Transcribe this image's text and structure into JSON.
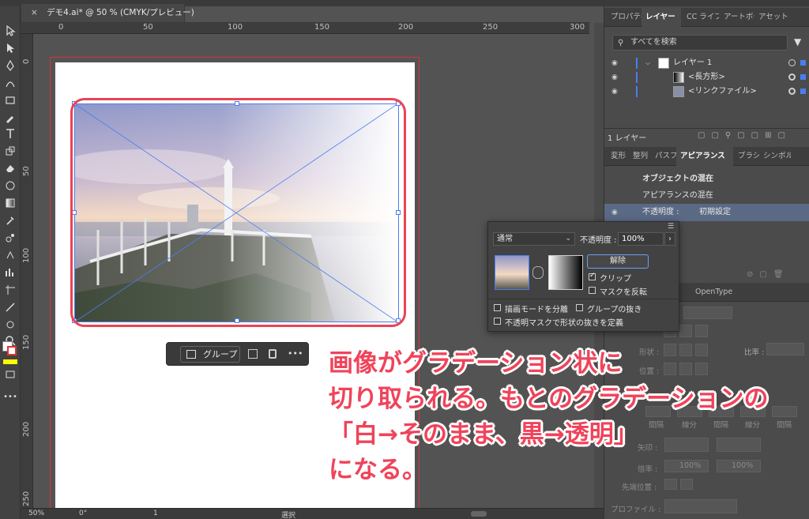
{
  "document_tab": {
    "close": "×",
    "title": "デモ4.ai* @ 50 % (CMYK/プレビュー)"
  },
  "ruler": {
    "h_ticks": [
      "0",
      "50",
      "100",
      "150",
      "200",
      "250",
      "300"
    ],
    "v_ticks": [
      "0",
      "50",
      "100",
      "150",
      "200",
      "250"
    ]
  },
  "context_bar": {
    "group_label": "グループ",
    "more": "•••"
  },
  "annotation": {
    "line1": "画像がグラデーション状に",
    "line2": "切り取られる。もとのグラデーションの",
    "line3": "「白→そのまま、黒→透明」",
    "line4": "になる。"
  },
  "status_bar": {
    "zoom": "50%",
    "rotate": "0°",
    "page": "1",
    "mode": "選択"
  },
  "panels": {
    "top_tabs": [
      "プロパティ",
      "レイヤー",
      "CC ライブラリ",
      "アートボード",
      "アセット"
    ],
    "search_placeholder": "すべてを検索",
    "layers": [
      {
        "name": "レイヤー 1"
      },
      {
        "name": "<長方形>"
      },
      {
        "name": "<リンクファイル>"
      }
    ],
    "layer_count": "1 レイヤー",
    "mid_tabs": [
      "変形",
      "整列",
      "パスファインダー",
      "アピアランス",
      "ブラシ",
      "シンボル"
    ],
    "appearance": {
      "row1": "オブジェクトの混在",
      "row2": "アピアランスの混在",
      "opacity_label": "不透明度 :",
      "opacity_value": "初期設定"
    },
    "stroke_tabs": [
      "OpenType"
    ],
    "stroke": {
      "ratio_label": "比率 :",
      "shape_label": "形状 :",
      "position_label": "位置 :",
      "line_labels": [
        "間隔",
        "線分",
        "間隔",
        "線分",
        "間隔"
      ],
      "arrow_label": "矢印 :",
      "scale_label": "倍率 :",
      "scale1": "100%",
      "scale2": "100%",
      "tip_label": "先端位置 :",
      "profile_label": "プロファイル :"
    }
  },
  "transparency": {
    "blend_mode": "通常",
    "opacity_label": "不透明度 :",
    "opacity_value": "100%",
    "release_button": "解除",
    "clip_label": "クリップ",
    "clip_checked": true,
    "invert_label": "マスクを反転",
    "invert_checked": false,
    "isolate_label": "描画モードを分離",
    "knockout_label": "グループの抜き",
    "opacity_mask_label": "不透明マスクで形状の抜きを定義"
  }
}
